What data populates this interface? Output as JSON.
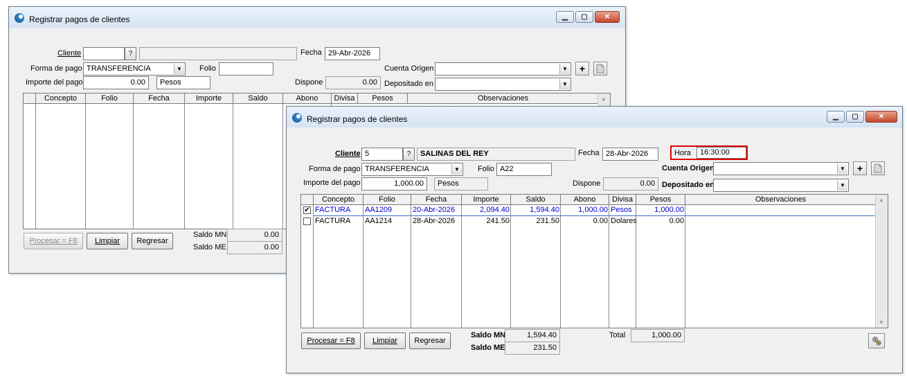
{
  "back_window": {
    "title": "Registrar pagos de clientes",
    "cliente_label": "Cliente",
    "cliente_id": "",
    "cliente_nombre": "",
    "help_button": "?",
    "fecha_label": "Fecha",
    "fecha_value": "29-Abr-2026",
    "forma_pago_label": "Forma de pago",
    "forma_pago_value": "TRANSFERENCIA",
    "folio_label": "Folio",
    "folio_value": "",
    "cuenta_origen_label": "Cuenta Origen",
    "cuenta_origen_value": "",
    "add_button": "+",
    "importe_label": "Importe del pago",
    "importe_value": "0.00",
    "moneda_value": "Pesos",
    "dispone_label": "Dispone",
    "dispone_value": "0.00",
    "depositado_label": "Depositado en",
    "depositado_value": "",
    "columns": [
      "Concepto",
      "Folio",
      "Fecha",
      "Importe",
      "Saldo",
      "Abono",
      "Divisa",
      "Pesos",
      "Observaciones"
    ],
    "procesar_button": "Procesar = F8",
    "limpiar_button": "Limpiar",
    "regresar_button": "Regresar",
    "saldo_mn_label": "Saldo MN",
    "saldo_mn_value": "0.00",
    "saldo_me_label": "Saldo ME",
    "saldo_me_value": "0.00"
  },
  "front_window": {
    "title": "Registrar pagos de clientes",
    "cliente_label": "Cliente",
    "cliente_id": "5",
    "help_button": "?",
    "cliente_nombre": "SALINAS DEL REY",
    "fecha_label": "Fecha",
    "fecha_value": "28-Abr-2026",
    "hora_label": "Hora",
    "hora_value": "16:30:00",
    "forma_pago_label": "Forma de pago",
    "forma_pago_value": "TRANSFERENCIA",
    "folio_label": "Folio",
    "folio_value": "A22",
    "cuenta_origen_label": "Cuenta Origen",
    "cuenta_origen_value": "",
    "add_button": "+",
    "importe_label": "Importe del pago",
    "importe_value": "1,000.00",
    "moneda_value": "Pesos",
    "dispone_label": "Dispone",
    "dispone_value": "0.00",
    "depositado_label": "Depositado en",
    "depositado_value": "",
    "columns": [
      "Concepto",
      "Folio",
      "Fecha",
      "Importe",
      "Saldo",
      "Abono",
      "Divisa",
      "Pesos",
      "Observaciones"
    ],
    "rows": [
      {
        "checked": true,
        "concepto": "FACTURA",
        "folio": "AA1209",
        "fecha": "20-Abr-2026",
        "importe": "2,094.40",
        "saldo": "1,594.40",
        "abono": "1,000.00",
        "divisa": "Pesos",
        "pesos": "1,000.00",
        "observaciones": ""
      },
      {
        "checked": false,
        "concepto": "FACTURA",
        "folio": "AA1214",
        "fecha": "28-Abr-2026",
        "importe": "241.50",
        "saldo": "231.50",
        "abono": "0.00",
        "divisa": "Dolares",
        "pesos": "0.00",
        "observaciones": ""
      }
    ],
    "procesar_button": "Procesar = F8",
    "limpiar_button": "Limpiar",
    "regresar_button": "Regresar",
    "saldo_mn_label": "Saldo MN",
    "saldo_mn_value": "1,594.40",
    "saldo_me_label": "Saldo ME",
    "saldo_me_value": "231.50",
    "total_label": "Total",
    "total_value": "1,000.00"
  },
  "colors": {
    "highlight_box": "#e00000",
    "selected_row_text": "#0000c8",
    "selection_line": "#3a6ec8"
  },
  "icons": {
    "app": "app-globe-icon",
    "minimize": "minimize-icon",
    "maximize": "maximize-icon",
    "close": "close-icon",
    "dropdown": "chevron-down-icon",
    "note": "note-icon",
    "settings": "gears-icon"
  }
}
